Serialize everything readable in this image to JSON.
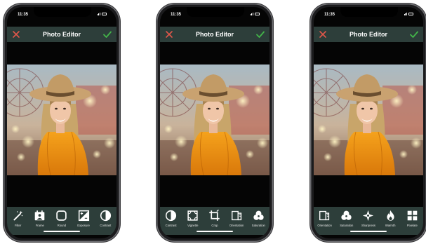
{
  "colors": {
    "toolbar_bg": "#2d3e3a",
    "close_icon": "#e0574a",
    "check_icon": "#43b649"
  },
  "phones": [
    {
      "status_time": "11:35",
      "header": {
        "title": "Photo Editor",
        "close_icon": "close-icon",
        "confirm_icon": "check-icon"
      },
      "tools": [
        {
          "label": "Filter",
          "icon": "magic-wand-icon"
        },
        {
          "label": "Frame",
          "icon": "frame-icon"
        },
        {
          "label": "Round",
          "icon": "rounded-square-icon"
        },
        {
          "label": "Exposure",
          "icon": "exposure-icon"
        },
        {
          "label": "Contrast",
          "icon": "contrast-icon"
        }
      ]
    },
    {
      "status_time": "11:35",
      "header": {
        "title": "Photo Editor",
        "close_icon": "close-icon",
        "confirm_icon": "check-icon"
      },
      "tools": [
        {
          "label": "Contrast",
          "icon": "contrast-icon"
        },
        {
          "label": "Vignette",
          "icon": "vignette-icon"
        },
        {
          "label": "Crop",
          "icon": "crop-icon"
        },
        {
          "label": "Orientation",
          "icon": "orientation-icon"
        },
        {
          "label": "Saturation",
          "icon": "saturation-icon"
        }
      ]
    },
    {
      "status_time": "11:35",
      "header": {
        "title": "Photo Editor",
        "close_icon": "close-icon",
        "confirm_icon": "check-icon"
      },
      "tools": [
        {
          "label": "Orientation",
          "icon": "orientation-icon"
        },
        {
          "label": "Saturation",
          "icon": "saturation-icon"
        },
        {
          "label": "Sharpness",
          "icon": "sharpness-icon"
        },
        {
          "label": "Warmth",
          "icon": "flame-icon"
        },
        {
          "label": "Pixelate",
          "icon": "pixelate-icon"
        }
      ]
    }
  ]
}
